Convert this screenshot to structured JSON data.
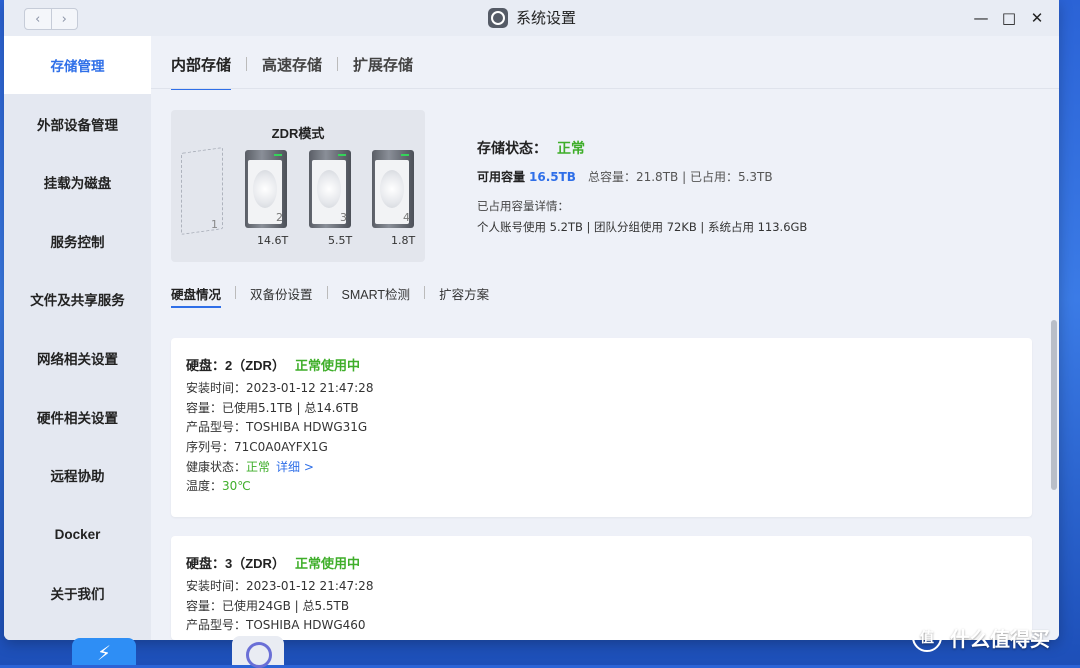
{
  "window": {
    "title": "系统设置"
  },
  "nav": {
    "back": "‹",
    "forward": "›"
  },
  "controls": {
    "minimize": "—",
    "maximize": "□",
    "close": "✕"
  },
  "sidebar": {
    "items": [
      {
        "label": "存储管理",
        "active": true
      },
      {
        "label": "外部设备管理"
      },
      {
        "label": "挂载为磁盘"
      },
      {
        "label": "服务控制"
      },
      {
        "label": "文件及共享服务"
      },
      {
        "label": "网络相关设置"
      },
      {
        "label": "硬件相关设置"
      },
      {
        "label": "远程协助"
      },
      {
        "label": "Docker"
      },
      {
        "label": "关于我们"
      }
    ]
  },
  "tabs": [
    {
      "label": "内部存储",
      "active": true
    },
    {
      "label": "高速存储"
    },
    {
      "label": "扩展存储"
    }
  ],
  "zdr": {
    "title": "ZDR模式",
    "slots": [
      {
        "num": "1",
        "empty": true,
        "size": ""
      },
      {
        "num": "2",
        "size": "14.6T"
      },
      {
        "num": "3",
        "size": "5.5T"
      },
      {
        "num": "4",
        "size": "1.8T"
      }
    ]
  },
  "storage": {
    "status_label": "存储状态：",
    "status_value": "正常",
    "available_label": "可用容量",
    "available_value": "16.5TB",
    "total": "总容量：21.8TB",
    "used": "已占用：5.3TB",
    "used_detail_title": "已占用容量详情：",
    "used_detail": "个人账号使用 5.2TB | 团队分组使用 72KB | 系统占用 113.6GB"
  },
  "subtabs": [
    {
      "label": "硬盘情况",
      "active": true
    },
    {
      "label": "双备份设置"
    },
    {
      "label": "SMART检测"
    },
    {
      "label": "扩容方案"
    }
  ],
  "disks": [
    {
      "title": "硬盘：2（ZDR）",
      "status": "正常使用中",
      "install_time": "安装时间：2023-01-12 21:47:28",
      "capacity": "容量：已使用5.1TB | 总14.6TB",
      "model": "产品型号：TOSHIBA HDWG31G",
      "serial": "序列号：71C0A0AYFX1G",
      "health_label": "健康状态：",
      "health_value": "正常",
      "health_link": "详细 >",
      "temp_label": "温度：",
      "temp_value": "30℃"
    },
    {
      "title": "硬盘：3（ZDR）",
      "status": "正常使用中",
      "install_time": "安装时间：2023-01-12 21:47:28",
      "capacity": "容量：已使用24GB | 总5.5TB",
      "model": "产品型号：TOSHIBA HDWG460"
    }
  ],
  "watermark": {
    "text": "什么值得买",
    "icon": "值"
  }
}
